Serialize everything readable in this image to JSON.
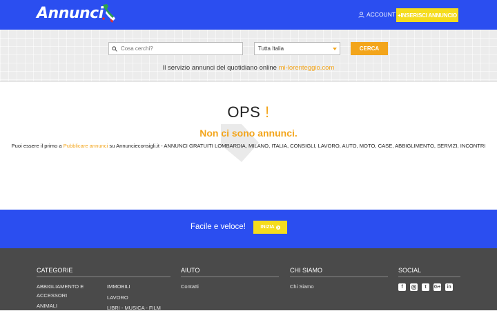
{
  "header": {
    "logo_text": "Annunci",
    "account_label": "ACCOUNT",
    "insert_label": "+INSERISCI ANNUNCIO"
  },
  "search": {
    "placeholder": "Cosa cerchi?",
    "region_value": "Tutta Italia",
    "button_label": "CERCA"
  },
  "tagline": {
    "text": "Il servizio annunci del quotidiano online ",
    "link": "mi-lorenteggio.com"
  },
  "empty_state": {
    "title": "OPS",
    "title_accent": "!",
    "message": "Non ci sono annunci.",
    "desc_prefix": "Puoi essere il primo a ",
    "desc_link": "Pubblicare annunci",
    "desc_suffix": " su Annuncieconsigli.it - ANNUNCI GRATUITI LOMBARDIA, MILANO, ITALIA, CONSIGLI, LAVORO, AUTO, MOTO, CASE, ABBIGLIMENTO, SERVIZI, INCONTRI"
  },
  "cta": {
    "text": "Facile e veloce!",
    "button_label": "INIZIA"
  },
  "footer": {
    "categories_title": "CATEGORIE",
    "categories_col1": [
      "ABBIGLIAMENTO E",
      "ACCESSORI",
      "ANIMALI"
    ],
    "categories_col2": [
      "IMMOBILI",
      "LAVORO",
      "LIBRI - MUSICA - FILM"
    ],
    "aiuto_title": "AIUTO",
    "aiuto_links": [
      "Contatti"
    ],
    "chisiamo_title": "CHI SIAMO",
    "chisiamo_links": [
      "Chi Siamo"
    ],
    "social_title": "SOCIAL",
    "social_icons": [
      "facebook-icon",
      "instagram-icon",
      "twitter-icon",
      "google-plus-icon",
      "linkedin-icon"
    ]
  },
  "colors": {
    "brand_blue": "#2b4ef0",
    "accent_orange": "#f3a51b",
    "accent_yellow": "#f5dc1d",
    "footer_bg": "#4a4a4a"
  }
}
